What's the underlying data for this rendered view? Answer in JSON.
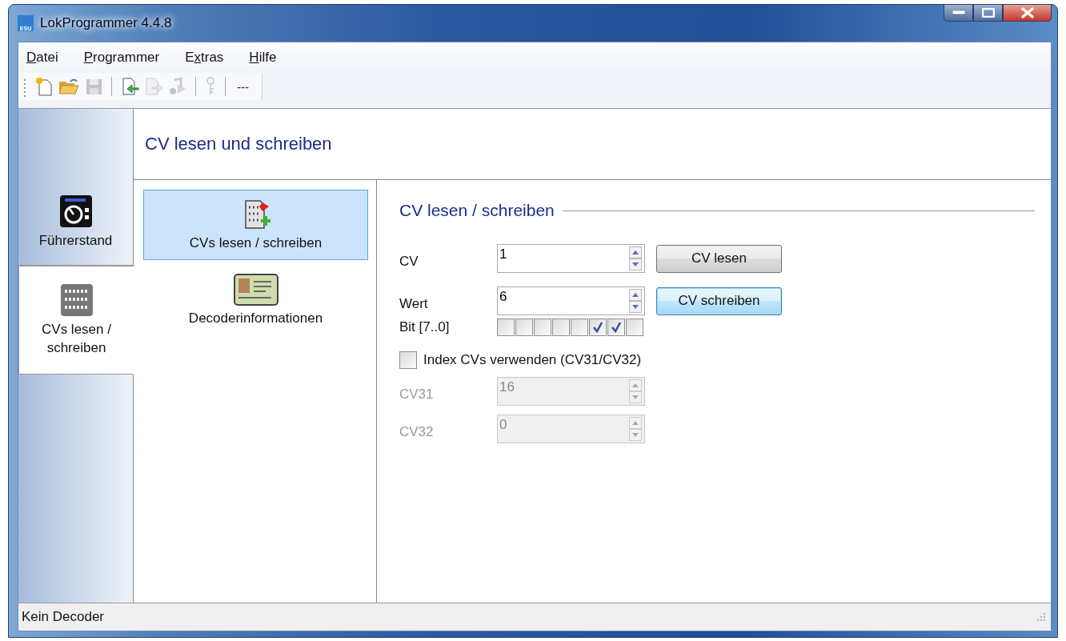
{
  "window": {
    "title": "LokProgrammer 4.4.8",
    "logo": "ESU"
  },
  "menu": [
    {
      "key": "D",
      "after": "atei"
    },
    {
      "key": "P",
      "after": "rogrammer"
    },
    {
      "before": "E",
      "key": "x",
      "after": "tras"
    },
    {
      "key": "H",
      "after": "ilfe"
    }
  ],
  "toolbar": {
    "groups": [
      [
        {
          "kind": "new",
          "disabled": false
        },
        {
          "kind": "open",
          "disabled": false
        },
        {
          "kind": "save",
          "disabled": true
        }
      ],
      [
        {
          "kind": "import",
          "disabled": false
        },
        {
          "kind": "export",
          "disabled": true
        },
        {
          "kind": "sound",
          "disabled": true
        }
      ],
      [
        {
          "kind": "key",
          "disabled": true
        }
      ],
      [
        {
          "kind": "text",
          "label": "---",
          "disabled": false
        }
      ]
    ]
  },
  "side_tabs": [
    {
      "label": "Führerstand",
      "kind": "cab",
      "selected": false
    },
    {
      "label": "CVs lesen / schreiben",
      "kind": "binary",
      "selected": true
    }
  ],
  "page_title": "CV lesen und schreiben",
  "nav_items": [
    {
      "label": "CVs lesen / schreiben",
      "kind": "cv",
      "selected": true
    },
    {
      "label": "Decoderinformationen",
      "kind": "card",
      "selected": false
    }
  ],
  "section_title": "CV lesen / schreiben",
  "fields": [
    {
      "label": "CV",
      "value": "1",
      "button": "CV lesen",
      "focused": false
    },
    {
      "label": "Wert",
      "value": "6",
      "button": "CV schreiben",
      "focused": true
    }
  ],
  "bits": {
    "label": "Bit [7..0]",
    "items": [
      {
        "checked": false
      },
      {
        "checked": false
      },
      {
        "checked": false
      },
      {
        "checked": false
      },
      {
        "checked": false
      },
      {
        "checked": true
      },
      {
        "checked": true
      },
      {
        "checked": false
      }
    ]
  },
  "index_option": {
    "label": "Index CVs verwenden (CV31/CV32)",
    "checked": false
  },
  "index_fields": [
    {
      "label": "CV31",
      "value": "16",
      "disabled": true
    },
    {
      "label": "CV32",
      "value": "0",
      "disabled": true
    }
  ],
  "status_bar": {
    "text": "Kein Decoder"
  }
}
